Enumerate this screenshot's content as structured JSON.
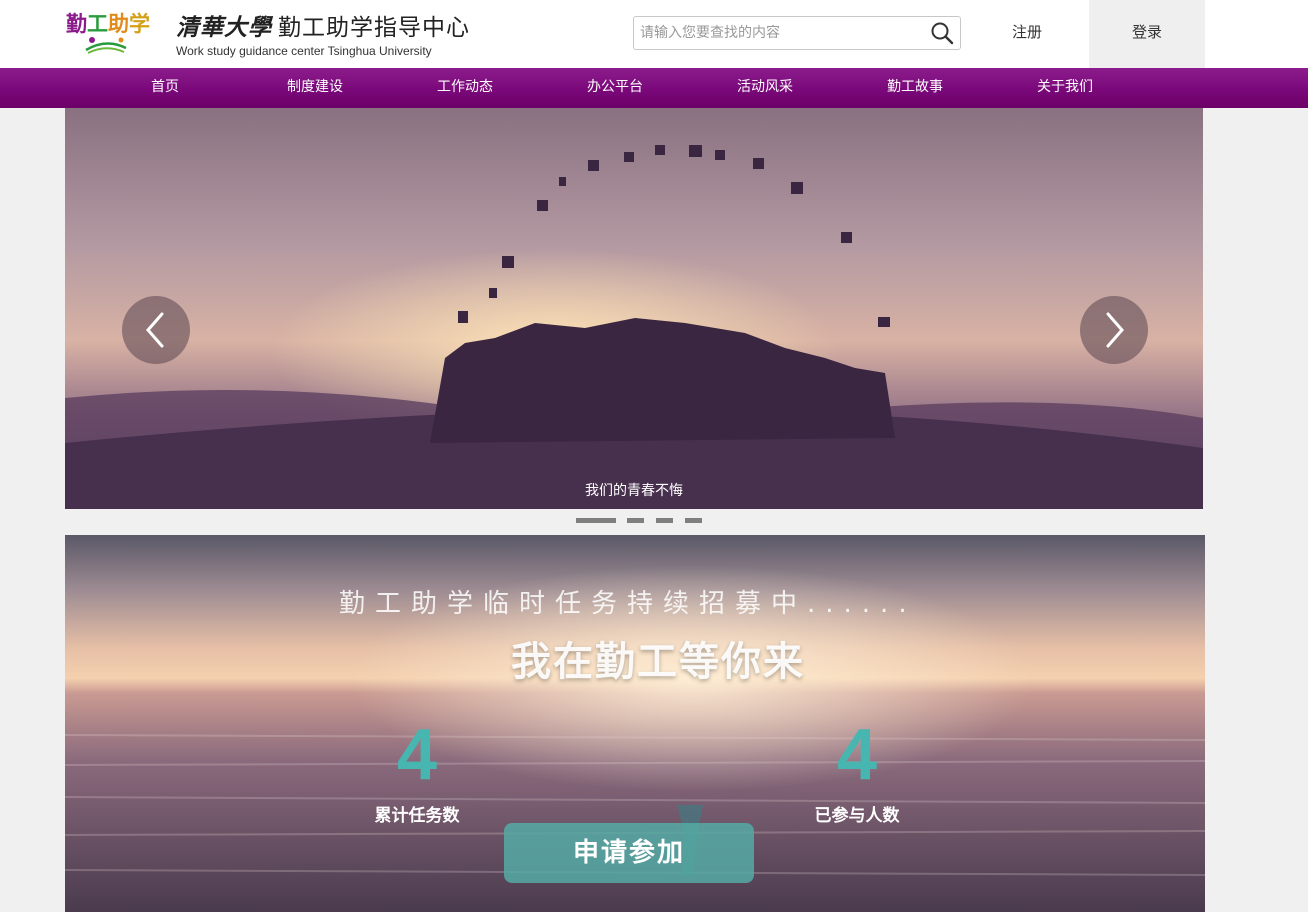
{
  "header": {
    "logo_text": [
      "勤",
      "工",
      "助",
      "学"
    ],
    "logo_sub": "Tsinghua University",
    "title_calligraphy": "清華大學",
    "title_cn": "勤工助学指导中心",
    "title_en": "Work study guidance center Tsinghua University",
    "search_placeholder": "请输入您要查找的内容",
    "search_icon": "search-icon",
    "register_label": "注册",
    "login_label": "登录"
  },
  "nav": {
    "items": [
      {
        "label": "首页"
      },
      {
        "label": "制度建设"
      },
      {
        "label": "工作动态"
      },
      {
        "label": "办公平台"
      },
      {
        "label": "活动风采"
      },
      {
        "label": "勤工故事"
      },
      {
        "label": "关于我们"
      }
    ],
    "color": "#7a087a"
  },
  "banner": {
    "caption": "我们的青春不悔",
    "prev_icon": "chevron-left-icon",
    "next_icon": "chevron-right-icon",
    "slide_count": 4,
    "active_slide": 1
  },
  "promo": {
    "subtitle": "勤工助学临时任务持续招募中......",
    "title": "我在勤工等你来",
    "stats": [
      {
        "value": "4",
        "label": "累计任务数"
      },
      {
        "value": "4",
        "label": "已参与人数"
      }
    ],
    "apply_label": "申请参加",
    "accent_color": "#48b6b0"
  }
}
